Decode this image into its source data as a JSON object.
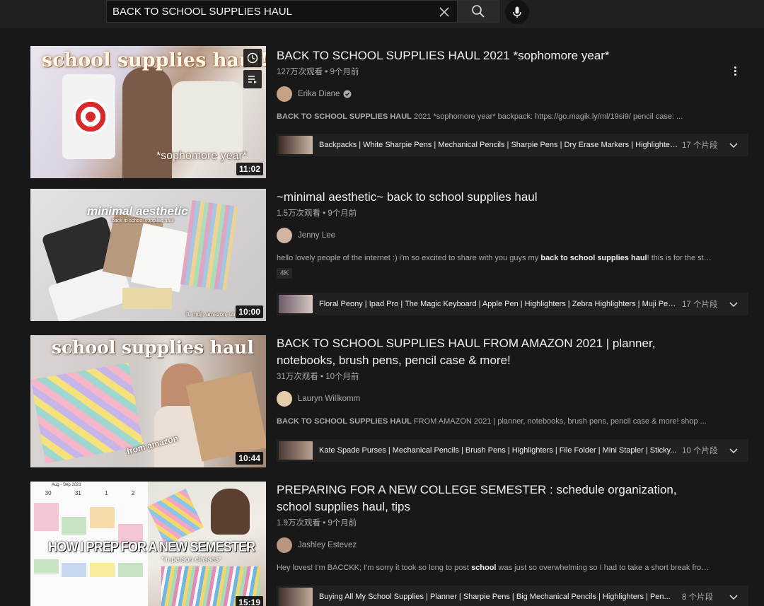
{
  "search": {
    "query": "BACK TO SCHOOL SUPPLIES HAUL"
  },
  "videos": [
    {
      "title": "BACK TO SCHOOL SUPPLIES HAUL 2021 *sophomore year*",
      "meta": "127万次观看 • 9个月前",
      "channel": "Erika Diane",
      "verified": true,
      "desc_bold": "BACK TO SCHOOL SUPPLIES HAUL",
      "desc_rest": " 2021 *sophomore year* backpack: https://go.magik.ly/ml/19si9/ pencil case: ...",
      "duration": "11:02",
      "thumb_text_top": "school supplies haul!",
      "thumb_text_bottom": "*sophomore year*",
      "chapters": "Backpacks | White Sharpie Pens | Mechanical Pencils | Sharpie Pens | Dry Erase Markers | Highlighters...",
      "chapter_count": "17 个片段"
    },
    {
      "title": "~minimal aesthetic~ back to school supplies haul",
      "meta": "1.5万次观看 • 9个月前",
      "channel": "Jenny Lee",
      "desc_pre": "hello lovely people of the internet :) i'm so excited to share with you guys my ",
      "desc_bold": "back to school supplies haul",
      "desc_rest": "! this is for the students ...",
      "badge": "4K",
      "duration": "10:00",
      "thumb_text_top": "minimal aesthetic",
      "thumb_text_sub": "back to school supplies haul",
      "thumb_text_bottom": "ft. muji, amazon, target, asian",
      "chapters": "Floral Peony | Ipad Pro | The Magic Keyboard | Apple Pen | Highlighters | Zebra Highlighters | Muji Pens...",
      "chapter_count": "17 个片段"
    },
    {
      "title": "BACK TO SCHOOL SUPPLIES HAUL FROM AMAZON 2021 | planner, notebooks, brush pens, pencil case & more!",
      "meta": "31万次观看 • 10个月前",
      "channel": "Lauryn Willkomm",
      "desc_bold": "BACK TO SCHOOL SUPPLIES HAUL",
      "desc_rest": " FROM AMAZON 2021 | planner, notebooks, brush pens, pencil case & more! shop ...",
      "duration": "10:44",
      "thumb_text_top": "school supplies haul",
      "thumb_text_bottom": "from amazon",
      "chapters": "Kate Spade Purses | Mechanical Pencils | Brush Pens | Highlighters | File Folder | Mini Stapler | Sticky...",
      "chapter_count": "10 个片段"
    },
    {
      "title": "PREPARING FOR A NEW COLLEGE SEMESTER : schedule organization, school supplies haul, tips",
      "meta": "1.9万次观看 • 9个月前",
      "channel": "Jashley Estevez",
      "desc_pre": "Hey loves! I'm BACCKK; I'm sorry it took so long to post ",
      "desc_bold": "school",
      "desc_rest": " was just so overwhelming so I had to take a short break from ...",
      "duration": "15:19",
      "thumb_text_top": "HOW I PREP FOR A NEW SEMESTER",
      "thumb_text_bottom": "*in person classes*",
      "thumb_cal_header": "Aug - Sep 2021",
      "thumb_cal_days": [
        "30",
        "31",
        "1",
        "2"
      ],
      "chapters": "Buying All My School Supplies | Planner | Sharpie Pens | Big Mechanical Pencils | Highlighters | Pen...",
      "chapter_count": "8 个片段"
    }
  ],
  "colors": {
    "background": "#181818",
    "topbar": "#202020",
    "chapter_bg": "#212121",
    "meta_text": "#aaaaaa"
  },
  "icons": [
    "clear-icon",
    "search-icon",
    "mic-icon",
    "more-vert-icon",
    "verified-icon",
    "chevron-down-icon",
    "watch-later-icon",
    "add-to-queue-icon"
  ]
}
